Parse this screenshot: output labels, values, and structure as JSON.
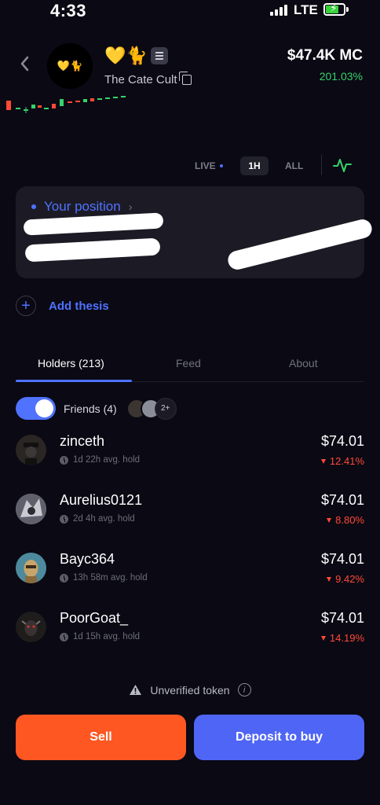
{
  "status_bar": {
    "time": "4:33",
    "network": "LTE"
  },
  "token": {
    "name": "The Cate Cult",
    "emoji": "💛🐈",
    "avatar_emoji": "💛🐈",
    "chain_icon": "solana-icon",
    "market_cap": "$47.4K MC",
    "change": "201.03%"
  },
  "timeframes": {
    "live": "LIVE",
    "one_hour": "1H",
    "all": "ALL"
  },
  "position": {
    "label": "Your position"
  },
  "add_thesis": {
    "label": "Add thesis"
  },
  "tabs": [
    {
      "label": "Holders (213)"
    },
    {
      "label": "Feed"
    },
    {
      "label": "About"
    }
  ],
  "friends": {
    "label": "Friends (4)",
    "more": "2+"
  },
  "holders": [
    {
      "name": "zinceth",
      "hold": "1d 22h avg. hold",
      "value": "$74.01",
      "change": "12.41%"
    },
    {
      "name": "Aurelius0121",
      "hold": "2d 4h avg. hold",
      "value": "$74.01",
      "change": "8.80%"
    },
    {
      "name": "Bayc364",
      "hold": "13h 58m avg. hold",
      "value": "$74.01",
      "change": "9.42%"
    },
    {
      "name": "PoorGoat_",
      "hold": "1d 15h avg. hold",
      "value": "$74.01",
      "change": "14.19%"
    }
  ],
  "warning": {
    "label": "Unverified token"
  },
  "actions": {
    "sell": "Sell",
    "deposit": "Deposit to buy"
  },
  "colors": {
    "accent": "#4f72ff",
    "positive": "#35d36a",
    "negative": "#ff4a36",
    "sell": "#ff5722",
    "deposit": "#4f65f5"
  }
}
